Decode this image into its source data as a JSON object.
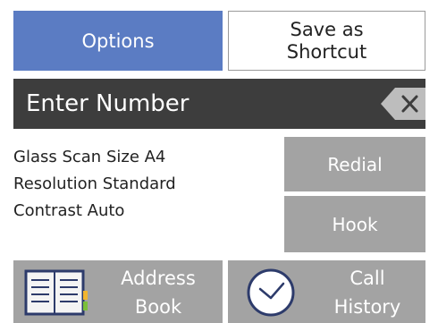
{
  "top": {
    "options_label": "Options",
    "shortcut_line1": "Save as",
    "shortcut_line2": "Shortcut"
  },
  "number_bar": {
    "placeholder": "Enter Number",
    "backspace_icon": "backspace-x-icon"
  },
  "settings": {
    "glass_scan": "Glass Scan Size A4",
    "resolution": "Resolution Standard",
    "contrast": "Contrast Auto"
  },
  "buttons": {
    "redial": "Redial",
    "hook": "Hook",
    "address_line1": "Address",
    "address_line2": "Book",
    "address_icon": "address-book-icon",
    "history_line1": "Call",
    "history_line2": "History",
    "history_icon": "clock-icon"
  },
  "colors": {
    "accent": "#5b7cc3",
    "button_gray": "#a3a3a3",
    "bar_dark": "#3d3d3d"
  }
}
